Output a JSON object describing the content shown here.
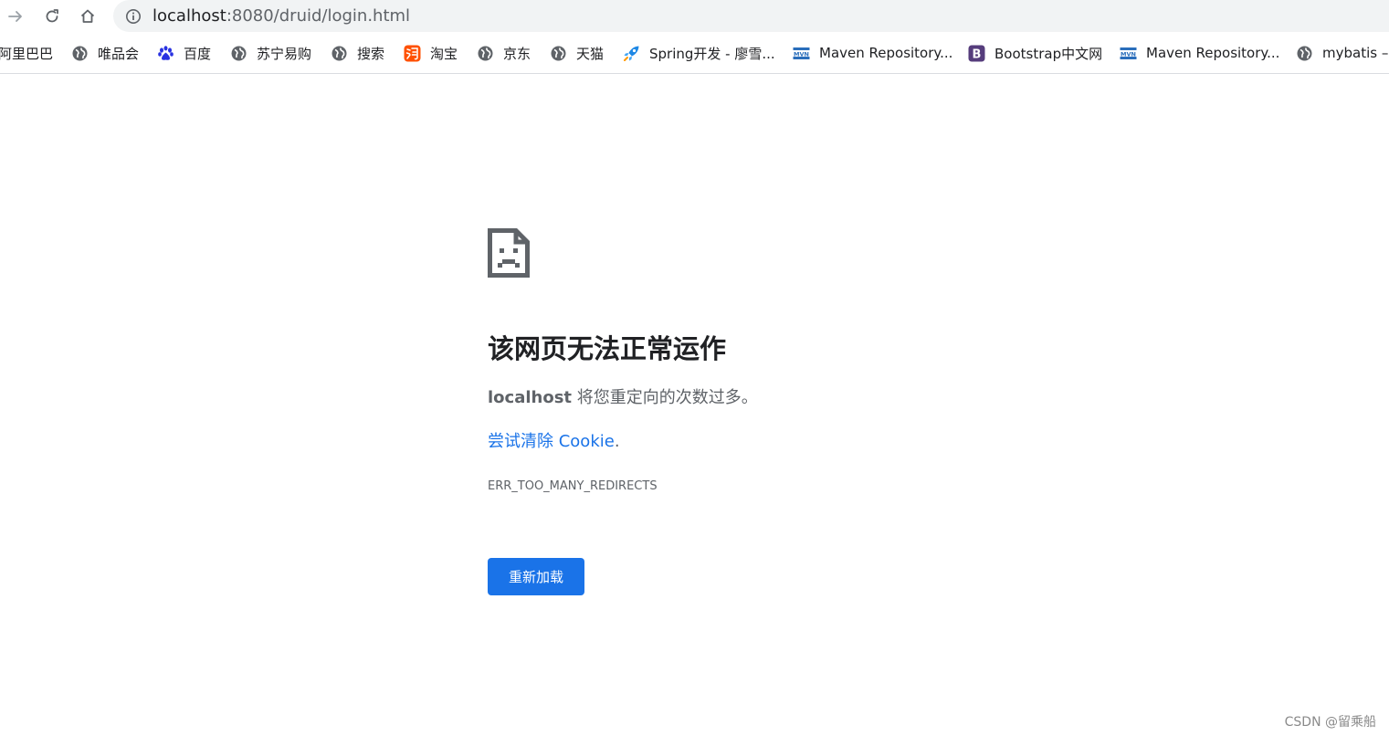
{
  "toolbar": {
    "url_host": "localhost",
    "url_rest": ":8080/druid/login.html"
  },
  "bookmarks": [
    {
      "label": "阿里巴巴",
      "icon": "none"
    },
    {
      "label": "唯品会",
      "icon": "globe-icon"
    },
    {
      "label": "百度",
      "icon": "baidu-paw-icon"
    },
    {
      "label": "苏宁易购",
      "icon": "globe-icon"
    },
    {
      "label": "搜索",
      "icon": "globe-icon"
    },
    {
      "label": "淘宝",
      "icon": "taobao-icon"
    },
    {
      "label": "京东",
      "icon": "globe-icon"
    },
    {
      "label": "天猫",
      "icon": "globe-icon"
    },
    {
      "label": "Spring开发 - 廖雪...",
      "icon": "rocket-icon"
    },
    {
      "label": "Maven Repository...",
      "icon": "mvn-icon"
    },
    {
      "label": "Bootstrap中文网",
      "icon": "bootstrap-icon"
    },
    {
      "label": "Maven Repository...",
      "icon": "mvn-icon"
    },
    {
      "label": "mybatis –",
      "icon": "globe-icon"
    }
  ],
  "error": {
    "title": "该网页无法正常运作",
    "host": "localhost",
    "summary_rest": " 将您重定向的次数过多。",
    "suggestion_link": "尝试清除 Cookie",
    "suggestion_end": ".",
    "code": "ERR_TOO_MANY_REDIRECTS",
    "reload_label": "重新加载"
  },
  "watermark": "CSDN @留乘船",
  "colors": {
    "accent": "#1a73e8",
    "text_secondary": "#5f6368",
    "omnibox_bg": "#f1f3f4"
  }
}
